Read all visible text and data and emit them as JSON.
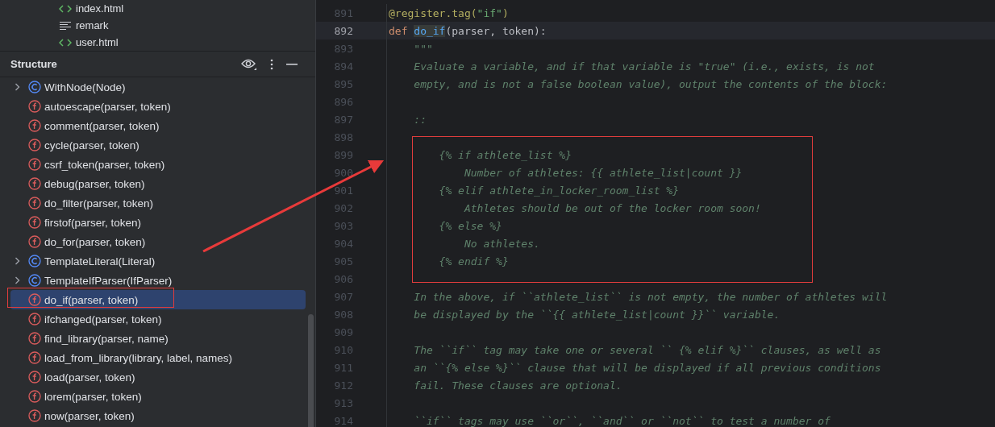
{
  "file_tree": [
    {
      "name": "index.html",
      "kind": "html"
    },
    {
      "name": "remark",
      "kind": "text"
    },
    {
      "name": "user.html",
      "kind": "html"
    }
  ],
  "structure": {
    "title": "Structure",
    "items": [
      {
        "label": "WithNode(Node)",
        "kind": "class",
        "expanded": false,
        "selected": false
      },
      {
        "label": "autoescape(parser, token)",
        "kind": "function",
        "selected": false
      },
      {
        "label": "comment(parser, token)",
        "kind": "function",
        "selected": false
      },
      {
        "label": "cycle(parser, token)",
        "kind": "function",
        "selected": false
      },
      {
        "label": "csrf_token(parser, token)",
        "kind": "function",
        "selected": false
      },
      {
        "label": "debug(parser, token)",
        "kind": "function",
        "selected": false
      },
      {
        "label": "do_filter(parser, token)",
        "kind": "function",
        "selected": false
      },
      {
        "label": "firstof(parser, token)",
        "kind": "function",
        "selected": false
      },
      {
        "label": "do_for(parser, token)",
        "kind": "function",
        "selected": false
      },
      {
        "label": "TemplateLiteral(Literal)",
        "kind": "class",
        "expanded": false,
        "selected": false
      },
      {
        "label": "TemplateIfParser(IfParser)",
        "kind": "class",
        "expanded": false,
        "selected": false
      },
      {
        "label": "do_if(parser, token)",
        "kind": "function",
        "selected": true
      },
      {
        "label": "ifchanged(parser, token)",
        "kind": "function",
        "selected": false
      },
      {
        "label": "find_library(parser, name)",
        "kind": "function",
        "selected": false
      },
      {
        "label": "load_from_library(library, label, names)",
        "kind": "function",
        "selected": false
      },
      {
        "label": "load(parser, token)",
        "kind": "function",
        "selected": false
      },
      {
        "label": "lorem(parser, token)",
        "kind": "function",
        "selected": false
      },
      {
        "label": "now(parser, token)",
        "kind": "function",
        "selected": false
      }
    ]
  },
  "editor": {
    "lines": [
      {
        "number": "891",
        "current": false,
        "tokens": [
          {
            "text": "@register.tag(",
            "kind": "decorator"
          },
          {
            "text": "\"if\"",
            "kind": "string"
          },
          {
            "text": ")",
            "kind": "decorator"
          }
        ]
      },
      {
        "number": "892",
        "current": true,
        "tokens": [
          {
            "text": "def ",
            "kind": "keyword"
          },
          {
            "text": "do_if",
            "kind": "function",
            "highlighted": true
          },
          {
            "text": "(parser, token):",
            "kind": "plain"
          }
        ]
      },
      {
        "number": "893",
        "current": false,
        "tokens": [
          {
            "text": "    \"\"\"",
            "kind": "doc"
          }
        ]
      },
      {
        "number": "894",
        "current": false,
        "tokens": [
          {
            "text": "    Evaluate a variable, and if that variable is \"true\" (i.e., exists, is not",
            "kind": "doc"
          }
        ]
      },
      {
        "number": "895",
        "current": false,
        "tokens": [
          {
            "text": "    empty, and is not a false boolean value), output the contents of the block:",
            "kind": "doc"
          }
        ]
      },
      {
        "number": "896",
        "current": false
      },
      {
        "number": "897",
        "current": false,
        "tokens": [
          {
            "text": "    ::",
            "kind": "doc"
          }
        ]
      },
      {
        "number": "898",
        "current": false
      },
      {
        "number": "899",
        "current": false,
        "tokens": [
          {
            "text": "        {% if athlete_list %}",
            "kind": "doc"
          }
        ]
      },
      {
        "number": "900",
        "current": false,
        "tokens": [
          {
            "text": "            Number of athletes: {{ athlete_list|count }}",
            "kind": "doc"
          }
        ]
      },
      {
        "number": "901",
        "current": false,
        "tokens": [
          {
            "text": "        {% elif athlete_in_locker_room_list %}",
            "kind": "doc"
          }
        ]
      },
      {
        "number": "902",
        "current": false,
        "tokens": [
          {
            "text": "            Athletes should be out of the locker room soon!",
            "kind": "doc"
          }
        ]
      },
      {
        "number": "903",
        "current": false,
        "tokens": [
          {
            "text": "        {% else %}",
            "kind": "doc"
          }
        ]
      },
      {
        "number": "904",
        "current": false,
        "tokens": [
          {
            "text": "            No athletes.",
            "kind": "doc"
          }
        ]
      },
      {
        "number": "905",
        "current": false,
        "tokens": [
          {
            "text": "        {% endif %}",
            "kind": "doc"
          }
        ]
      },
      {
        "number": "906",
        "current": false
      },
      {
        "number": "907",
        "current": false,
        "tokens": [
          {
            "text": "    In the above, if ``athlete_list`` is not empty, the number of athletes will",
            "kind": "doc"
          }
        ]
      },
      {
        "number": "908",
        "current": false,
        "tokens": [
          {
            "text": "    be displayed by the ``{{ athlete_list|count }}`` variable.",
            "kind": "doc"
          }
        ]
      },
      {
        "number": "909",
        "current": false
      },
      {
        "number": "910",
        "current": false,
        "tokens": [
          {
            "text": "    The ``if`` tag may take one or several `` {% elif %}`` clauses, as well as",
            "kind": "doc"
          }
        ]
      },
      {
        "number": "911",
        "current": false,
        "tokens": [
          {
            "text": "    an ``{% else %}`` clause that will be displayed if all previous conditions",
            "kind": "doc"
          }
        ]
      },
      {
        "number": "912",
        "current": false,
        "tokens": [
          {
            "text": "    fail. These clauses are optional.",
            "kind": "doc"
          }
        ]
      },
      {
        "number": "913",
        "current": false
      },
      {
        "number": "914",
        "current": false,
        "tokens": [
          {
            "text": "    ``if`` tags may use ``or``, ``and`` or ``not`` to test a number of",
            "kind": "doc"
          }
        ]
      }
    ]
  }
}
